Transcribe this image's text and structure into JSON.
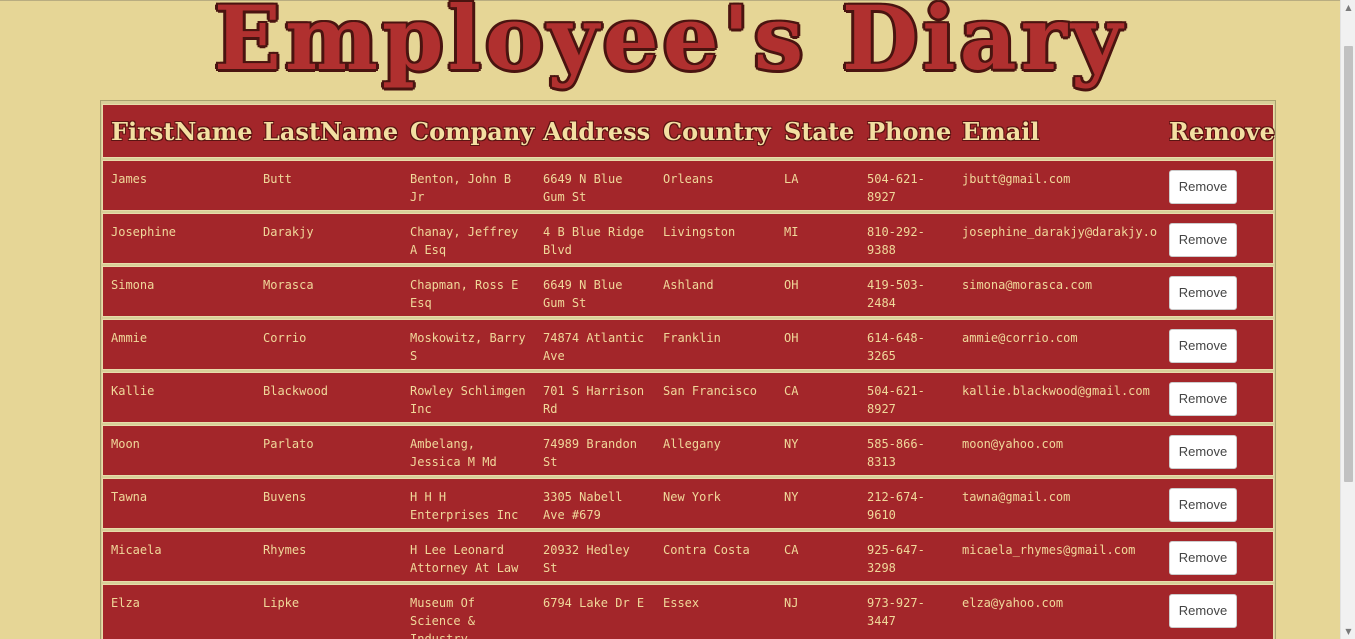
{
  "title": "Employee's Diary",
  "columns": [
    "FirstName",
    "LastName",
    "Company",
    "Address",
    "Country",
    "State",
    "Phone",
    "Email",
    "Remove"
  ],
  "rows": [
    {
      "first": "James",
      "last": "Butt",
      "company": "Benton, John B Jr",
      "address": "6649 N Blue Gum St",
      "country": "Orleans",
      "state": "LA",
      "phone": "504-621-8927",
      "email": "jbutt@gmail.com",
      "remove": "Remove"
    },
    {
      "first": "Josephine",
      "last": "Darakjy",
      "company": "Chanay, Jeffrey A Esq",
      "address": "4 B Blue Ridge Blvd",
      "country": "Livingston",
      "state": "MI",
      "phone": "810-292-9388",
      "email": "josephine_darakjy@darakjy.org",
      "remove": "Remove"
    },
    {
      "first": "Simona",
      "last": "Morasca",
      "company": "Chapman, Ross E Esq",
      "address": "6649 N Blue Gum St",
      "country": "Ashland",
      "state": "OH",
      "phone": "419-503-2484",
      "email": "simona@morasca.com",
      "remove": "Remove"
    },
    {
      "first": "Ammie",
      "last": "Corrio",
      "company": "Moskowitz, Barry S",
      "address": "74874 Atlantic Ave",
      "country": "Franklin",
      "state": "OH",
      "phone": "614-648-3265",
      "email": "ammie@corrio.com",
      "remove": "Remove"
    },
    {
      "first": "Kallie",
      "last": "Blackwood",
      "company": "Rowley Schlimgen Inc",
      "address": "701 S Harrison Rd",
      "country": "San Francisco",
      "state": "CA",
      "phone": "504-621-8927",
      "email": "kallie.blackwood@gmail.com",
      "remove": "Remove"
    },
    {
      "first": "Moon",
      "last": "Parlato",
      "company": "Ambelang, Jessica M Md",
      "address": "74989 Brandon St",
      "country": "Allegany",
      "state": "NY",
      "phone": "585-866-8313",
      "email": "moon@yahoo.com",
      "remove": "Remove"
    },
    {
      "first": "Tawna",
      "last": "Buvens",
      "company": "H H H Enterprises Inc",
      "address": "3305 Nabell Ave #679",
      "country": "New York",
      "state": "NY",
      "phone": "212-674-9610",
      "email": "tawna@gmail.com",
      "remove": "Remove"
    },
    {
      "first": "Micaela",
      "last": "Rhymes",
      "company": "H Lee Leonard Attorney At Law",
      "address": "20932 Hedley St",
      "country": "Contra Costa",
      "state": "CA",
      "phone": "925-647-3298",
      "email": "micaela_rhymes@gmail.com",
      "remove": "Remove"
    },
    {
      "first": "Elza",
      "last": "Lipke",
      "company": "Museum Of Science & Industry",
      "address": "6794 Lake Dr E",
      "country": "Essex",
      "state": "NJ",
      "phone": "973-927-3447",
      "email": "elza@yahoo.com",
      "remove": "Remove"
    }
  ],
  "scrollbar": {
    "up_icon": "scroll-up-arrow-icon",
    "down_icon": "scroll-down-arrow-icon"
  }
}
